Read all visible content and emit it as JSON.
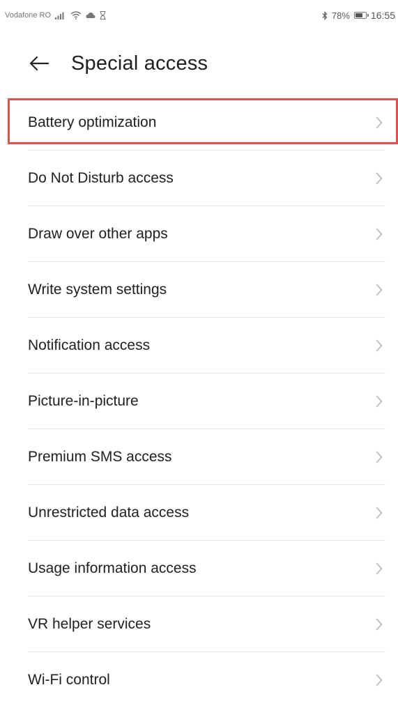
{
  "status_bar": {
    "carrier": "Vodafone RO",
    "signal_icon": "signal-bars-icon",
    "wifi_icon": "wifi-icon",
    "cloud_icon": "cloud-icon",
    "hourglass_icon": "hourglass-icon",
    "bluetooth_icon": "bluetooth-icon",
    "battery_percent": "78%",
    "battery_level": 0.78,
    "time": "16:55"
  },
  "header": {
    "back_icon": "back-arrow-icon",
    "title": "Special access"
  },
  "list": {
    "chevron_icon": "chevron-right-icon",
    "highlight_color": "#d9534f",
    "items": [
      {
        "label": "Battery optimization",
        "highlighted": true
      },
      {
        "label": "Do Not Disturb access",
        "highlighted": false
      },
      {
        "label": "Draw over other apps",
        "highlighted": false
      },
      {
        "label": "Write system settings",
        "highlighted": false
      },
      {
        "label": "Notification access",
        "highlighted": false
      },
      {
        "label": "Picture-in-picture",
        "highlighted": false
      },
      {
        "label": "Premium SMS access",
        "highlighted": false
      },
      {
        "label": "Unrestricted data access",
        "highlighted": false
      },
      {
        "label": "Usage information access",
        "highlighted": false
      },
      {
        "label": "VR helper services",
        "highlighted": false
      },
      {
        "label": "Wi-Fi control",
        "highlighted": false
      }
    ]
  }
}
